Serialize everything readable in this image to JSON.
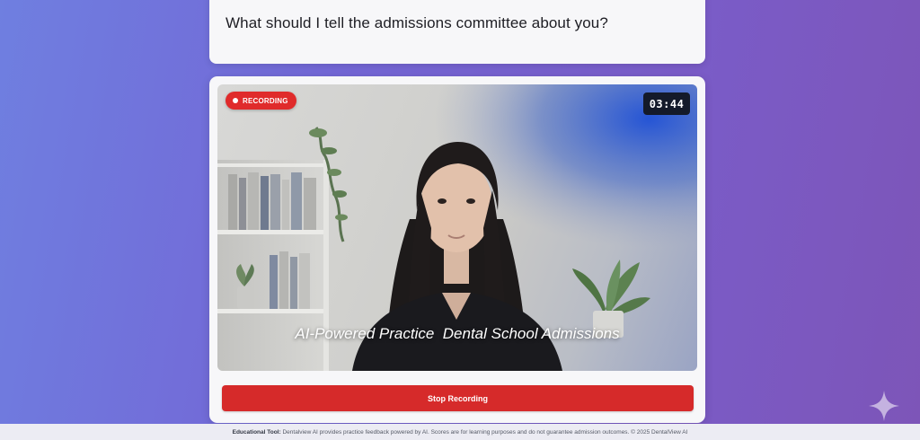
{
  "question": {
    "text": "What should I tell the admissions committee about you?"
  },
  "video": {
    "recording_label": "RECORDING",
    "timer": "03:44",
    "caption": "AI-Powered Practice  Dental School Admissions"
  },
  "controls": {
    "stop_label": "Stop Recording"
  },
  "footer": {
    "label": "Educational Tool:",
    "text": "Dentalview AI provides practice feedback powered by AI. Scores are for learning purposes and do not guarantee admission outcomes. © 2025 DentalView AI"
  },
  "colors": {
    "record_red": "#e02b2b",
    "stop_button_red": "#d62a2a",
    "timer_bg": "#141a2a",
    "background_start": "#6f7fe0",
    "background_end": "#7d55b8"
  },
  "icons": {
    "record": "record-dot-icon",
    "sparkle": "sparkle-icon"
  }
}
